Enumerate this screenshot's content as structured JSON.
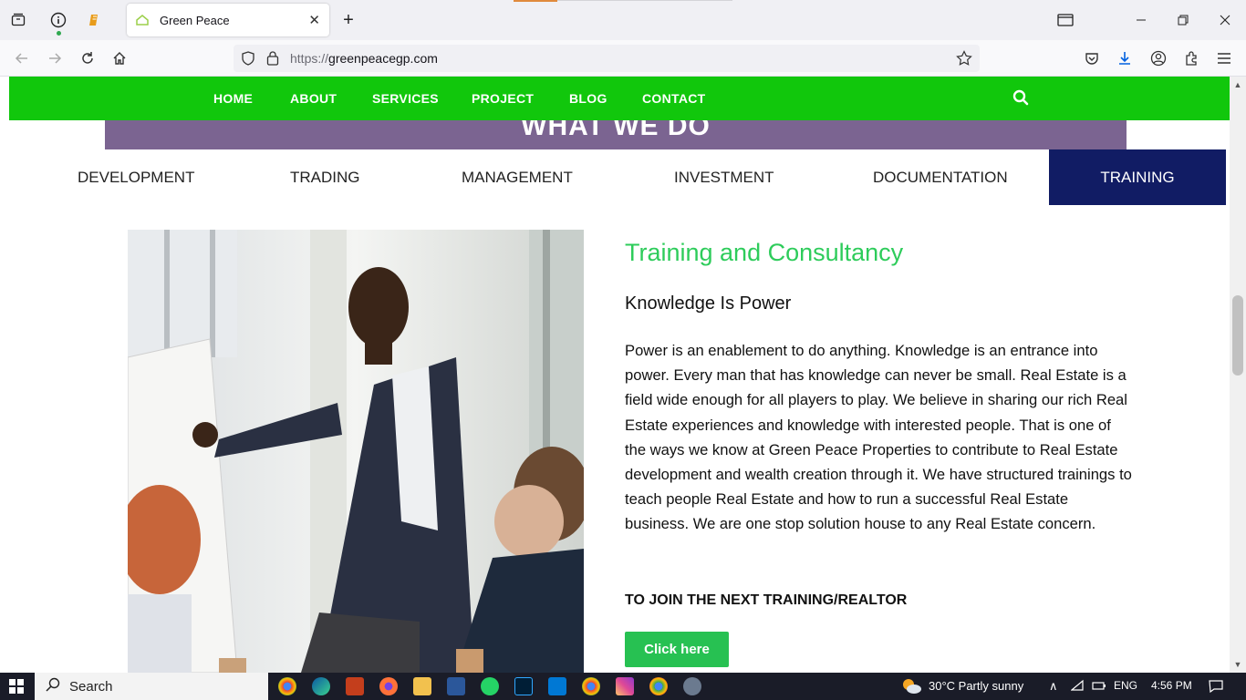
{
  "browser": {
    "tab_title": "Green Peace",
    "url_protocol": "https://",
    "url_host": "greenpeacegp.com"
  },
  "site": {
    "nav": [
      "HOME",
      "ABOUT",
      "SERVICES",
      "PROJECT",
      "BLOG",
      "CONTACT"
    ],
    "section_heading": "WHAT WE DO",
    "tabs": [
      "DEVELOPMENT",
      "TRADING",
      "MANAGEMENT",
      "INVESTMENT",
      "DOCUMENTATION"
    ],
    "active_tab": "TRAINING",
    "title": "Training and Consultancy",
    "subtitle": "Knowledge Is Power",
    "body": "Power is an enablement to do anything. Knowledge is an entrance into power. Every man that has knowledge can never be small. Real Estate is a field wide enough for all players to play. We believe in sharing our rich Real Estate experiences and knowledge with interested people. That is one of the ways we know at Green Peace Properties to contribute to Real Estate development and wealth creation through it. We have structured trainings to teach people Real Estate and how to run a successful Real Estate business. We are one stop solution house to any Real Estate concern.",
    "join_text": "TO JOIN THE NEXT TRAINING/REALTOR",
    "button_label": "Click here",
    "colors": {
      "nav_green": "#11c70c",
      "heading_purple": "#7b6491",
      "active_tab_navy": "#111c64",
      "title_green": "#2ecc5b",
      "button_green": "#27c152"
    }
  },
  "taskbar": {
    "search_label": "Search",
    "weather": "30°C  Partly sunny",
    "language": "ENG",
    "time": "4:56 PM"
  }
}
